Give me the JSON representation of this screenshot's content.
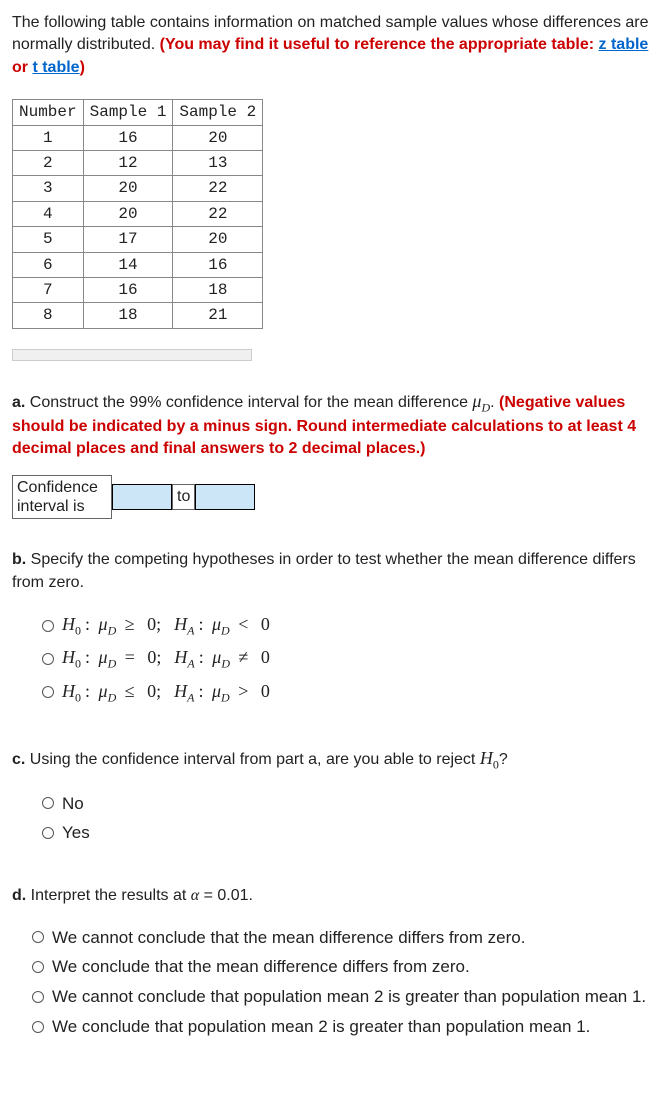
{
  "intro": {
    "text": "The following table contains information on matched sample values whose differences are normally distributed.",
    "hint_prefix": "(You may find it useful to reference the appropriate table: ",
    "z_link": "z table",
    "or_text": " or ",
    "t_link": "t table",
    "hint_suffix": ")"
  },
  "table": {
    "headers": {
      "num": "Number",
      "s1": "Sample 1",
      "s2": "Sample 2"
    },
    "rows": [
      {
        "n": "1",
        "s1": "16",
        "s2": "20"
      },
      {
        "n": "2",
        "s1": "12",
        "s2": "13"
      },
      {
        "n": "3",
        "s1": "20",
        "s2": "22"
      },
      {
        "n": "4",
        "s1": "20",
        "s2": "22"
      },
      {
        "n": "5",
        "s1": "17",
        "s2": "20"
      },
      {
        "n": "6",
        "s1": "14",
        "s2": "16"
      },
      {
        "n": "7",
        "s1": "16",
        "s2": "18"
      },
      {
        "n": "8",
        "s1": "18",
        "s2": "21"
      }
    ]
  },
  "part_a": {
    "label": "a.",
    "text": " Construct the 99% confidence interval for the mean difference ",
    "mu": "μ",
    "sub": "D",
    "period": ". ",
    "hint": "(Negative values should be indicated by a minus sign. Round intermediate calculations to at least 4 decimal places and final answers to 2 decimal places.)",
    "ci_label": "Confidence interval is",
    "to": "to"
  },
  "part_b": {
    "label": "b.",
    "text": " Specify the competing hypotheses in order to test whether the mean difference differs from zero.",
    "options": [
      {
        "h0": "H₀: μD ≥ 0; ",
        "ha": "HA: μD < 0",
        "op1": "≥",
        "op2": "<"
      },
      {
        "h0": "H₀: μD = 0; ",
        "ha": "HA: μD ≠ 0",
        "op1": "=",
        "op2": "≠"
      },
      {
        "h0": "H₀: μD ≤ 0; ",
        "ha": "HA: μD > 0",
        "op1": "≤",
        "op2": ">"
      }
    ]
  },
  "part_c": {
    "label": "c.",
    "text": " Using the confidence interval from part a, are you able to reject ",
    "h0": "H",
    "sub": "0",
    "q": "?",
    "options": [
      "No",
      "Yes"
    ]
  },
  "part_d": {
    "label": "d.",
    "text": " Interpret the results at ",
    "alpha": "α",
    "eq": " = 0.01.",
    "options": [
      "We cannot conclude that the mean difference differs from zero.",
      "We conclude that the mean difference differs from zero.",
      "We cannot conclude that population mean 2 is greater than population mean 1.",
      "We conclude that population mean 2 is greater than population mean 1."
    ]
  }
}
